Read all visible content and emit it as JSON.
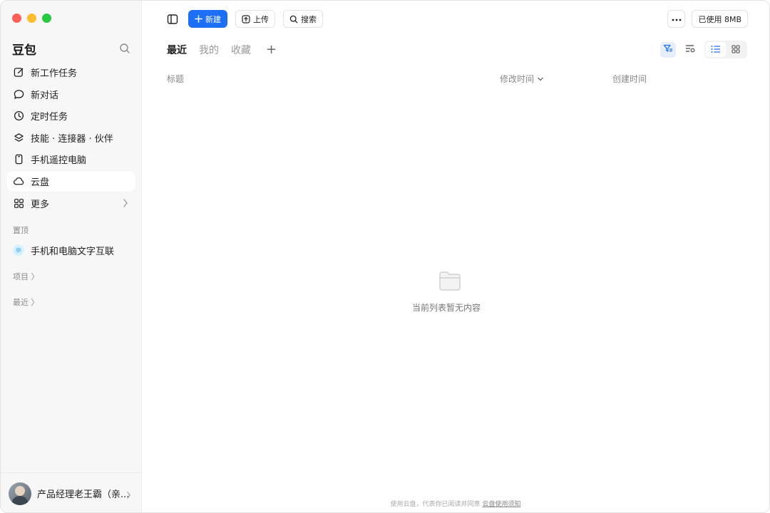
{
  "app": {
    "brand": "豆包"
  },
  "sidebar": {
    "items": [
      {
        "label": "新工作任务",
        "icon": "edit-icon"
      },
      {
        "label": "新对话",
        "icon": "chat-bubble-icon"
      },
      {
        "label": "定时任务",
        "icon": "clock-icon"
      },
      {
        "label": "技能 · 连接器 · 伙伴",
        "icon": "layers-icon"
      },
      {
        "label": "手机遥控电脑",
        "icon": "phone-icon"
      },
      {
        "label": "云盘",
        "icon": "cloud-icon",
        "active": true
      },
      {
        "label": "更多",
        "icon": "grid-icon"
      }
    ],
    "pinned_label": "置顶",
    "pinned_items": [
      {
        "label": "手机和电脑文字互联",
        "icon": "chat-dot-icon"
      }
    ],
    "projects_label": "项目 〉",
    "recent_label": "最近 〉",
    "user": {
      "name": "产品经理老王霸（亲..."
    }
  },
  "toolbar": {
    "new_label": "新建",
    "upload_label": "上传",
    "search_label": "搜索",
    "usage_label": "已使用 8MB"
  },
  "tabs": [
    {
      "label": "最近",
      "active": true
    },
    {
      "label": "我的"
    },
    {
      "label": "收藏"
    }
  ],
  "tab_add": "+",
  "table": {
    "columns": {
      "title": "标题",
      "modified": "修改时间",
      "created": "创建时间"
    },
    "rows": []
  },
  "empty_state": {
    "text": "当前列表暂无内容"
  },
  "footer": {
    "text": "使用云盘，代表你已阅读并同意",
    "link": "云盘使用须知"
  },
  "colors": {
    "accent": "#1d6ff5",
    "sidebar_bg": "#f7f7f8"
  }
}
